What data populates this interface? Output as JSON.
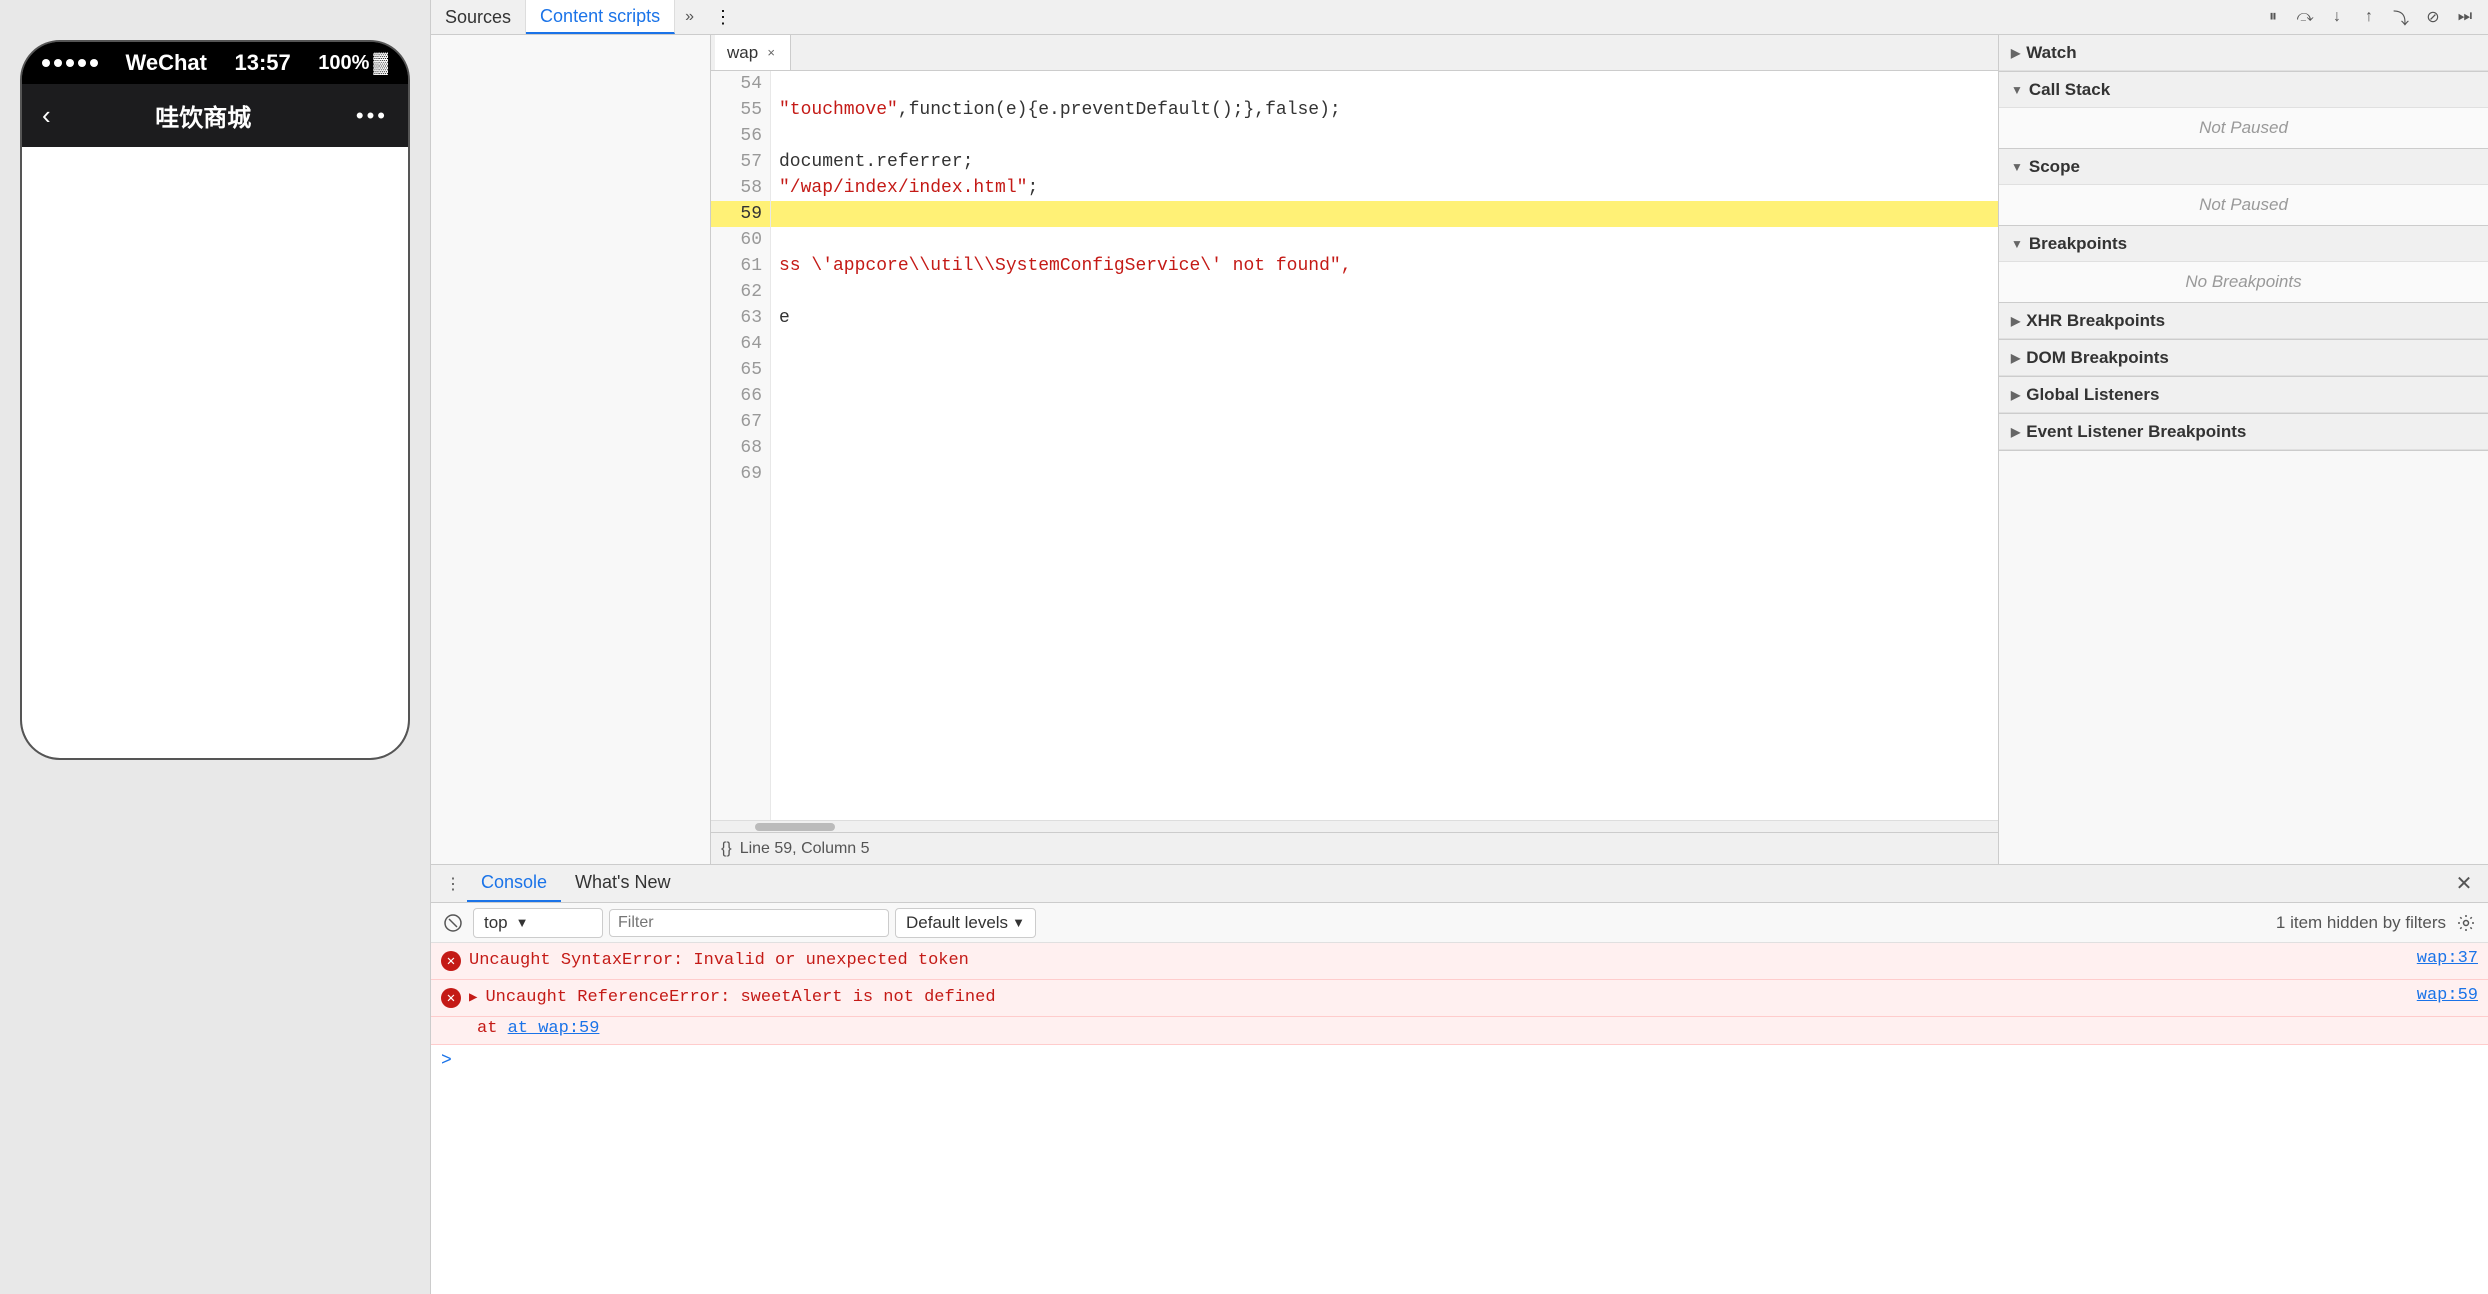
{
  "phone": {
    "status_bar": {
      "dots_count": 5,
      "network": "WeChat",
      "time": "13:57",
      "battery": "100%"
    },
    "nav": {
      "back_icon": "‹",
      "title": "哇饮商城",
      "menu": "•••"
    }
  },
  "devtools": {
    "top_tabs": {
      "sources": "Sources",
      "content_scripts": "Content scripts",
      "more": "»",
      "menu": "⋮"
    },
    "toolbar_buttons": [
      "⏸",
      "↺",
      "↓",
      "↑",
      "⤵",
      "⏭"
    ],
    "code_tab": {
      "name": "wap",
      "close": "×"
    },
    "lines": [
      {
        "num": "54",
        "code": "",
        "highlight": false
      },
      {
        "num": "55",
        "code": "\"touchmove\",function(e){e.preventDefault();},false);",
        "highlight": false
      },
      {
        "num": "56",
        "code": "",
        "highlight": false
      },
      {
        "num": "57",
        "code": "document.referrer;",
        "highlight": false
      },
      {
        "num": "58",
        "code": "\"/wap/index/index.html\";",
        "highlight": false
      },
      {
        "num": "59",
        "code": "",
        "highlight": true
      },
      {
        "num": "60",
        "code": "",
        "highlight": false
      },
      {
        "num": "61",
        "code": "ss \\'appcore\\\\util\\\\SystemConfigService\\' not found\",",
        "highlight": false
      },
      {
        "num": "62",
        "code": "",
        "highlight": false
      },
      {
        "num": "63",
        "code": "e",
        "highlight": false
      },
      {
        "num": "64",
        "code": "",
        "highlight": false
      },
      {
        "num": "65",
        "code": "",
        "highlight": false
      },
      {
        "num": "66",
        "code": "",
        "highlight": false
      },
      {
        "num": "67",
        "code": "",
        "highlight": false
      },
      {
        "num": "68",
        "code": "",
        "highlight": false
      },
      {
        "num": "69",
        "code": "",
        "highlight": false
      }
    ],
    "status_bar": {
      "brace_icon": "{}",
      "position": "Line 59, Column 5"
    },
    "right_sidebar": {
      "sections": {
        "watch": {
          "label": "Watch",
          "collapsed": false
        },
        "call_stack": {
          "label": "Call Stack",
          "not_paused": "Not Paused"
        },
        "scope": {
          "label": "Scope",
          "not_paused": "Not Paused"
        },
        "breakpoints": {
          "label": "Breakpoints",
          "no_breakpoints": "No Breakpoints"
        },
        "xhr_breakpoints": {
          "label": "XHR Breakpoints"
        },
        "dom_breakpoints": {
          "label": "DOM Breakpoints"
        },
        "global_listeners": {
          "label": "Global Listeners"
        },
        "event_listener_breakpoints": {
          "label": "Event Listener Breakpoints"
        }
      }
    }
  },
  "console": {
    "tabs": [
      "Console",
      "What's New"
    ],
    "active_tab": "Console",
    "toolbar": {
      "context_selector": "top",
      "filter_placeholder": "Filter",
      "levels": "Default levels",
      "hidden_text": "1 item hidden by filters"
    },
    "messages": [
      {
        "type": "error",
        "icon": "✕",
        "text": "Uncaught SyntaxError: Invalid or unexpected token",
        "link": "wap:37",
        "expandable": false
      },
      {
        "type": "error",
        "icon": "✕",
        "text": "Uncaught ReferenceError: sweetAlert is not defined",
        "link": "wap:59",
        "expandable": true,
        "sub": "at wap:59"
      }
    ],
    "prompt": ">"
  }
}
